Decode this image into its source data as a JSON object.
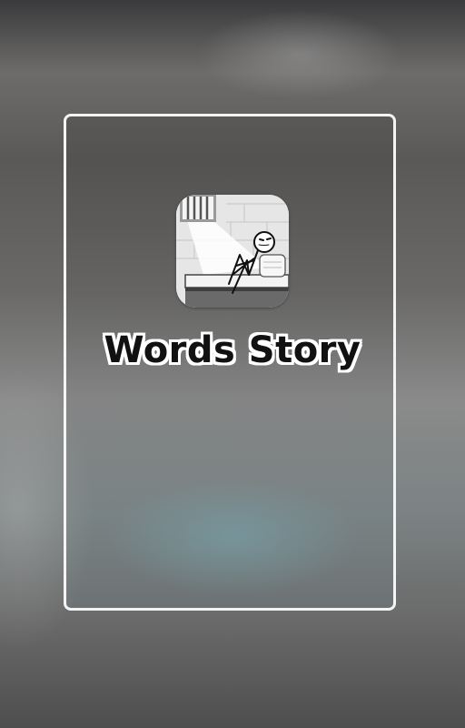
{
  "app": {
    "title": "Words Story",
    "icon": "stickman-prison-cell-icon"
  },
  "colors": {
    "frame_border": "#f4f4f4",
    "title_text": "#111111",
    "title_outline": "#ffffff"
  }
}
